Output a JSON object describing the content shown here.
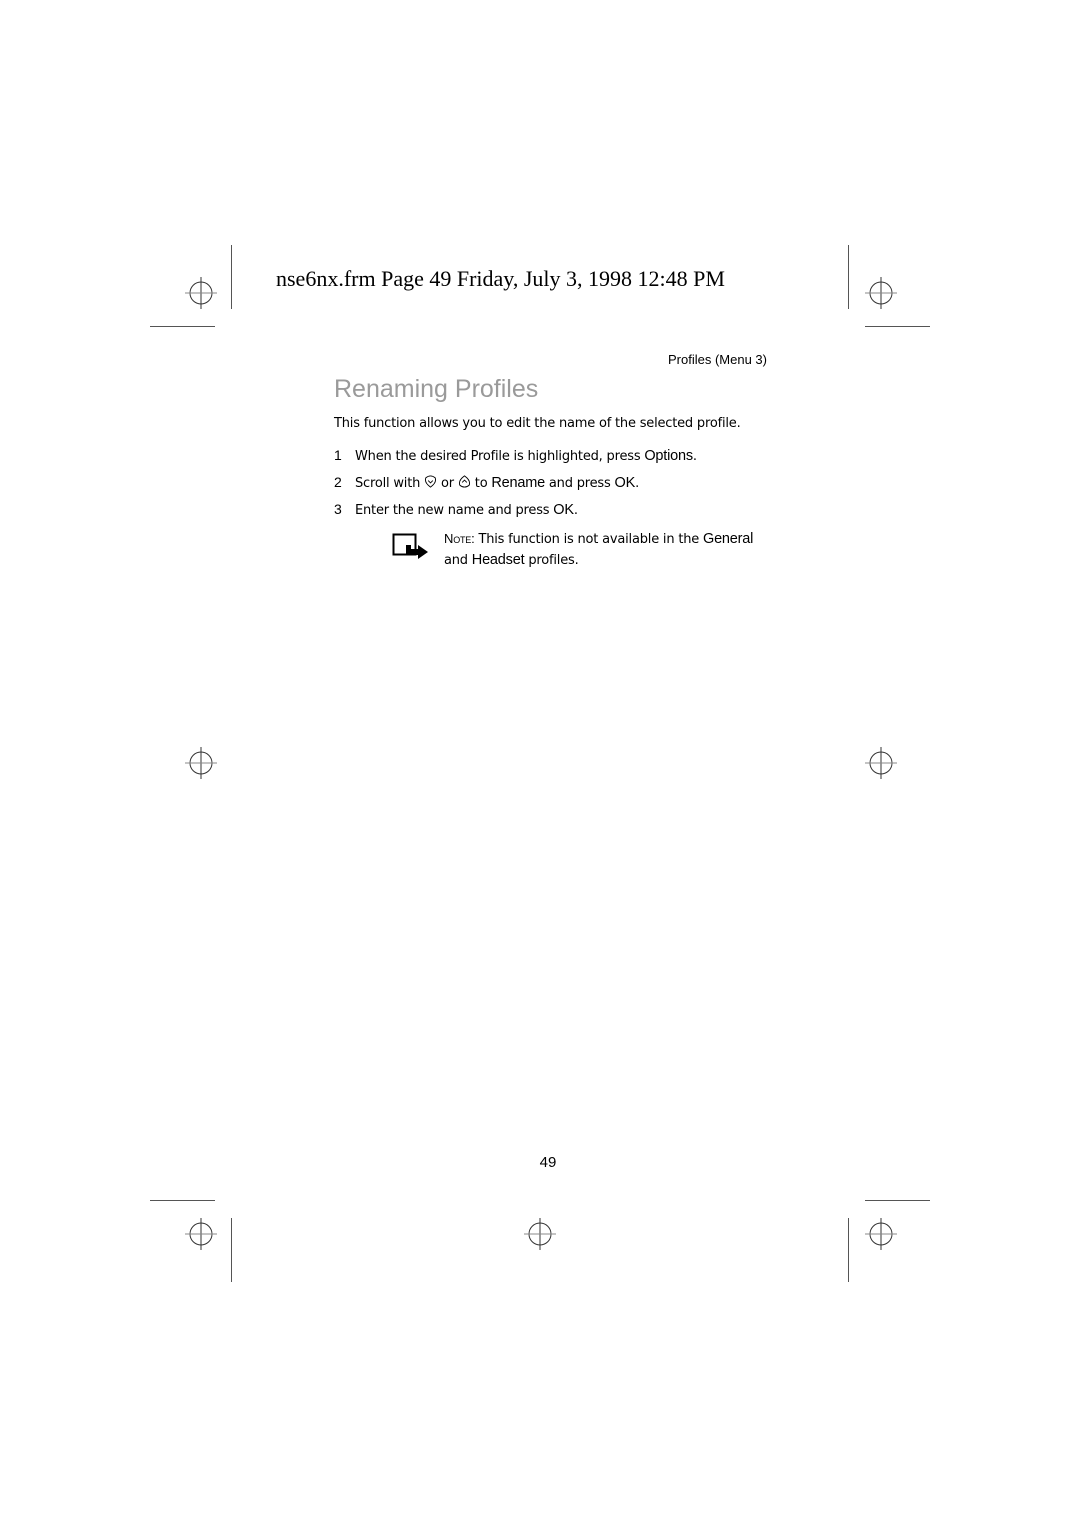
{
  "header": {
    "text": "nse6nx.frm  Page 49  Friday, July 3, 1998  12:48 PM"
  },
  "running_head": "Profiles (Menu 3)",
  "section": {
    "title": "Renaming Profiles",
    "intro": "This function allows you to edit the name of the selected profile."
  },
  "steps": [
    {
      "number": "1",
      "text_before": "When the desired Profile is highlighted, press ",
      "keyword": "Options",
      "text_after": "."
    },
    {
      "number": "2",
      "text_scroll": "Scroll with ",
      "down_icon": "scroll-down-key-icon",
      "text_or": " or ",
      "up_icon": "scroll-up-key-icon",
      "text_to": " to ",
      "keyword1": "Rename",
      "text_mid": " and press ",
      "keyword2": "OK",
      "text_after": "."
    },
    {
      "number": "3",
      "text_before": "Enter the new name and press ",
      "keyword": "OK",
      "text_after": "."
    }
  ],
  "note": {
    "icon": "note-hand-pointer-icon",
    "label": "Note:",
    "text_before": " This function is not available in the ",
    "keyword1": "General",
    "text_mid": " and ",
    "keyword2": "Headset",
    "text_after": " profiles."
  },
  "page_number": "49"
}
